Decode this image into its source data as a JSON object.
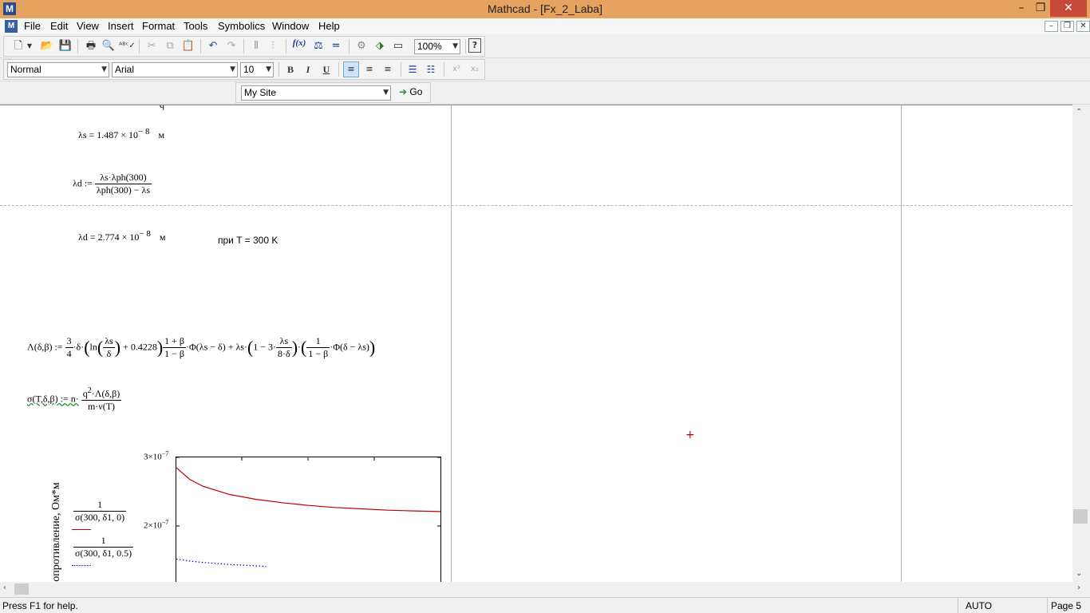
{
  "window": {
    "title": "Mathcad - [Fx_2_Laba]",
    "app_icon_label": "M"
  },
  "menu": {
    "items": [
      "File",
      "Edit",
      "View",
      "Insert",
      "Format",
      "Tools",
      "Symbolics",
      "Window",
      "Help"
    ]
  },
  "toolbar_standard": {
    "zoom_value": "100%"
  },
  "toolbar_format": {
    "style_value": "Normal",
    "font_value": "Arial",
    "size_value": "10"
  },
  "toolbar_web": {
    "url_value": "My Site",
    "go_label": "Go"
  },
  "worksheet": {
    "lambda_s_result": {
      "lhs": "λs = 1.487 × 10",
      "exp": "− 8",
      "unit": "м"
    },
    "lambda_d_def": {
      "lhs": "λd :=",
      "num": "λs·λph(300)",
      "den": "λph(300) − λs"
    },
    "lambda_d_result": {
      "lhs": "λd = 2.774 × 10",
      "exp": "− 8",
      "unit": "м"
    },
    "note": "при T = 300 K",
    "Lambda_def": {
      "lhs": "Λ(δ,β) :=",
      "coef_num": "3",
      "coef_den": "4",
      "p1": "·δ·",
      "ln": "ln",
      "ln_num": "λs",
      "ln_den": "δ",
      "p2": "+ 0.4228",
      "f2_num": "1 + β",
      "f2_den": "1 − β",
      "p3": "·Φ(λs − δ) + λs·",
      "p4": "1 − 3·",
      "f3_num": "λs",
      "f3_den": "8·δ",
      "f4_num": "1",
      "f4_den": "1 − β",
      "p5": "·Φ(δ − λs)"
    },
    "sigma_def": {
      "lhs": "σ(T,δ,β) := n·",
      "num_base": "q",
      "num_exp": "2",
      "num_rest": "·Λ(δ,β)",
      "den": "m·ν(T)"
    },
    "plot": {
      "ylabel": "сопротивление, Ом*м",
      "y_tick_top": "3×10",
      "y_tick_mid": "2×10",
      "y_tick_exp": "−7",
      "legend_1_num": "1",
      "legend_1_den": "σ(300, δ1, 0)",
      "legend_2_num": "1",
      "legend_2_den": "σ(300, δ1, 0.5)"
    }
  },
  "status": {
    "help": "Press F1 for help.",
    "mode": "AUTO",
    "page": "Page 5"
  },
  "colors": {
    "titlebar": "#e6a35f",
    "close": "#c7493a",
    "series1": "#c00000",
    "series2": "#0000cc"
  },
  "chart_data": {
    "type": "line",
    "ylabel": "сопротивление, Ом*м",
    "ylim": [
      1.4e-07,
      3e-07
    ],
    "y_ticks": [
      "3×10−7",
      "2×10−7"
    ],
    "series": [
      {
        "name": "1/σ(300, δ1, 0)",
        "style": "solid",
        "color": "#c00000",
        "x": [
          0,
          0.05,
          0.1,
          0.2,
          0.3,
          0.4,
          0.5,
          0.6,
          0.7,
          0.8,
          0.9,
          1.0
        ],
        "values": [
          2.85e-07,
          2.68e-07,
          2.58e-07,
          2.46e-07,
          2.39e-07,
          2.34e-07,
          2.3e-07,
          2.27e-07,
          2.25e-07,
          2.23e-07,
          2.22e-07,
          2.21e-07
        ]
      },
      {
        "name": "1/σ(300, δ1, 0.5)",
        "style": "dotted",
        "color": "#0000cc",
        "x": [
          0,
          0.05,
          0.1,
          0.2,
          0.3,
          0.34
        ],
        "values": [
          1.52e-07,
          1.49e-07,
          1.47e-07,
          1.44e-07,
          1.42e-07,
          1.41e-07
        ]
      }
    ]
  }
}
